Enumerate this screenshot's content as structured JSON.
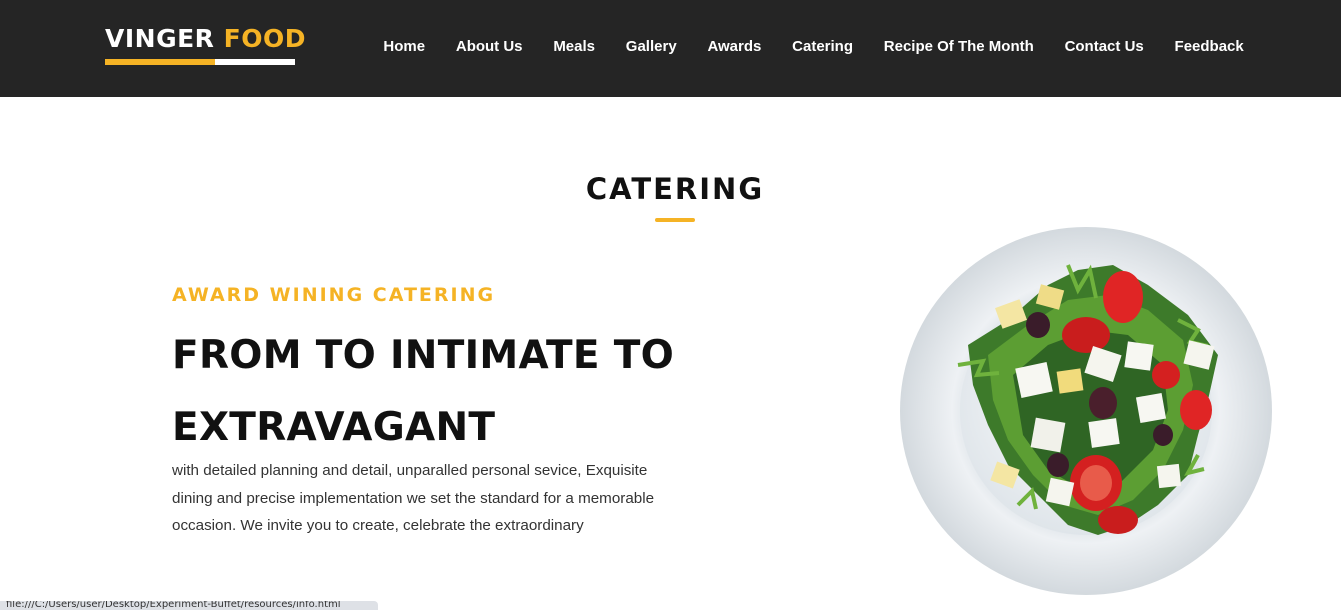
{
  "brand": {
    "word1": "VINGER",
    "word2": "FOOD",
    "accent_color": "#f5b325"
  },
  "nav": {
    "items": [
      {
        "label": "Home"
      },
      {
        "label": "About Us"
      },
      {
        "label": "Meals"
      },
      {
        "label": "Gallery"
      },
      {
        "label": "Awards"
      },
      {
        "label": "Catering"
      },
      {
        "label": "Recipe Of The Month"
      },
      {
        "label": "Contact Us"
      },
      {
        "label": "Feedback"
      }
    ]
  },
  "section": {
    "title": "CATERING",
    "eyebrow": "AWARD WINING CATERING",
    "headline": "FROM TO INTIMATE TO EXTRAVAGANT",
    "body": "with detailed planning and detail, unparalled personal sevice, Exquisite dining and precise implementation we set the standard for a memorable occasion. We invite you to create, celebrate the extraordinary",
    "image": "salad-plate-image"
  },
  "statusbar": {
    "text": "file:///C:/Users/user/Desktop/Experiment-Buffet/resources/info.html"
  }
}
